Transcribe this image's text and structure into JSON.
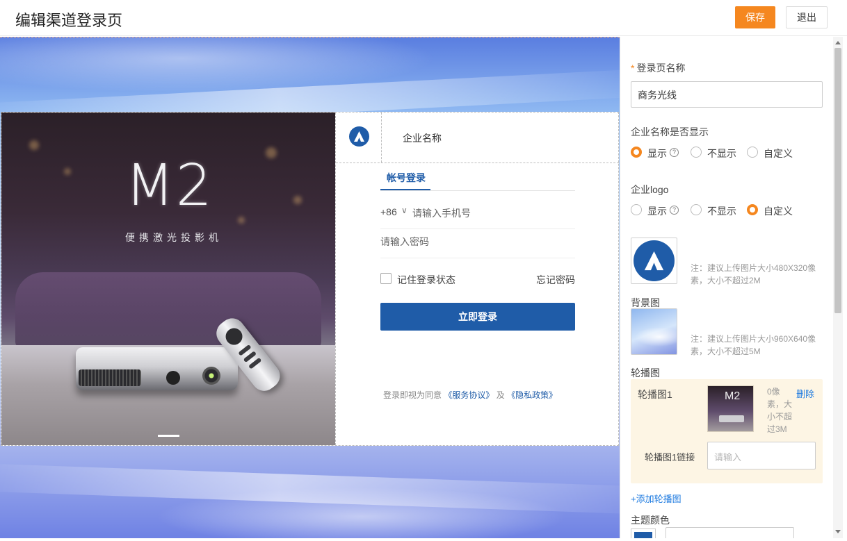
{
  "header": {
    "title": "编辑渠道登录页",
    "save_label": "保存",
    "exit_label": "退出"
  },
  "preview": {
    "carousel": {
      "headline": "M2",
      "subtitle": "便携激光投影机",
      "active_slide": 1
    },
    "company_name": "企业名称",
    "tab_label": "帐号登录",
    "phone": {
      "code": "+86",
      "placeholder": "请输入手机号"
    },
    "password_placeholder": "请输入密码",
    "remember_label": "记住登录状态",
    "forgot_label": "忘记密码",
    "login_button": "立即登录",
    "agreement": {
      "prefix": "登录即视为同意",
      "terms": "《服务协议》",
      "and": "及",
      "privacy": "《隐私政策》"
    }
  },
  "panel": {
    "name_field": {
      "label": "登录页名称",
      "required_mark": "*",
      "value": "商务光线"
    },
    "show_company_name": {
      "label": "企业名称是否显示",
      "options": [
        "显示",
        "不显示",
        "自定义"
      ],
      "selected": "显示"
    },
    "company_logo": {
      "label": "企业logo",
      "options": [
        "显示",
        "不显示",
        "自定义"
      ],
      "selected": "自定义",
      "note": "注：建议上传图片大小480X320像素，大小不超过2M"
    },
    "background": {
      "label": "背景图",
      "note": "注：建议上传图片大小960X640像素，大小不超过5M"
    },
    "carousel": {
      "label": "轮播图",
      "item_label": "轮播图1",
      "item_note": "0像素，大小不超过3M",
      "delete_label": "删除",
      "link_label": "轮播图1链接",
      "link_placeholder": "请输入"
    },
    "add_carousel": "+添加轮播图",
    "theme_color": {
      "label": "主题颜色",
      "value": "#1f5ca8"
    }
  }
}
